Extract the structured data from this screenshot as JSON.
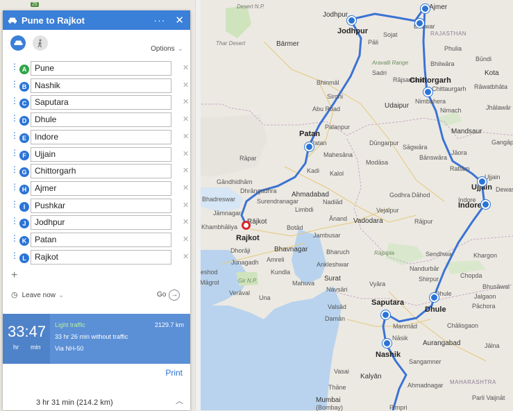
{
  "panel": {
    "title": "Pune to Rajkot",
    "more_label": "···",
    "close_label": "✕",
    "options_label": "Options",
    "stops": [
      {
        "letter": "A",
        "value": "Pune"
      },
      {
        "letter": "B",
        "value": "Nashik"
      },
      {
        "letter": "C",
        "value": "Saputara"
      },
      {
        "letter": "D",
        "value": "Dhule"
      },
      {
        "letter": "E",
        "value": "Indore"
      },
      {
        "letter": "F",
        "value": "Ujjain"
      },
      {
        "letter": "G",
        "value": "Chittorgarh"
      },
      {
        "letter": "H",
        "value": "Ajmer"
      },
      {
        "letter": "I",
        "value": "Pushkar"
      },
      {
        "letter": "J",
        "value": "Jodhpur"
      },
      {
        "letter": "K",
        "value": "Patan"
      },
      {
        "letter": "L",
        "value": "Rajkot"
      }
    ],
    "add_stop_label": "+",
    "leave_label": "Leave now",
    "go_label": "Go",
    "summary": {
      "time": "33:47",
      "hr_label": "hr",
      "min_label": "min",
      "traffic": "Light traffic",
      "distance": "2129.7 km",
      "no_traffic": "33 hr 26 min without traffic",
      "via": "Via NH-50"
    },
    "print_label": "Print",
    "step_summary": "3 hr 31 min (214.2 km)"
  },
  "map": {
    "route_color": "#3b73d4",
    "labels": {
      "desert_np": "Desert\nN.P.",
      "thar": "Thar Desert",
      "barmer": "Bärmer",
      "jodhpur": "Jodhpur",
      "jodhpur_bold": "Jodhpur",
      "ajmer": "Ajmer",
      "beawar": "Beawar",
      "sojat": "Sojat",
      "pali": "Pāli",
      "bhilwara": "Bhilwāra",
      "rajasthan": "RAJASTHAN",
      "phulia": "Phulia",
      "bundi": "Būndi",
      "kota": "Kota",
      "aravalli": "Aravalli Range",
      "sadri": "Sadri",
      "rajsamand": "Rājsamand",
      "chittorgarh": "Chittorgarh",
      "chittaurgarh": "Chittaurgarh",
      "rawatbhata": "Rāwatbhāta",
      "bhinmal": "Bhinmāl",
      "sirohi": "Sirohi",
      "udaipur": "Udaipur",
      "nimbahera": "Nimbahera",
      "jhalawar": "Jhālawār",
      "nimach": "Nimach",
      "aburoad": "Abu Road",
      "palanpur": "Palanpur",
      "mandsaur": "Mandsaur",
      "dungarpur": "Dūngarpur",
      "patan": "Patan",
      "patan_small": "Patan",
      "sagwara": "Sāgwāra",
      "gangapur": "Gangāpur",
      "mahesana": "Mahesāna",
      "banswara": "Bānswāra",
      "jaora": "Jāora",
      "rapar": "Rāpar",
      "kadi": "Kadi",
      "modasa": "Modāsa",
      "ratlam": "Ratlām",
      "kaloi": "Kalol",
      "gandhidham": "Gāndhidhām",
      "ujjain": "Ujjain",
      "ujjain_small": "Ujjain",
      "dewas": "Dewas",
      "dhrangadhra": "Dhrāngadhra",
      "ahmadabad": "Ahmadabad",
      "godhra": "Godhra",
      "dahod": "Dāhod",
      "bhadreswar": "Bhadreswar",
      "surendranagar": "Surendranagar",
      "nadiad": "Nadiād",
      "indore": "Indore",
      "indore_small": "Indore",
      "jamnagar": "Jāmnagar",
      "limbdi": "Limbdi",
      "anand": "Ānand",
      "vejalpur": "Vejalpur",
      "khambhaliya": "Khambhāliya",
      "rajkot": "Rājkot",
      "rajkot_bold": "Rajkot",
      "botad": "Botād",
      "vadodara": "Vadodara",
      "rajpur": "Rājpur",
      "jambusar": "Jambusar",
      "dhoraji": "Dhorāji",
      "bhavnagar": "Bhavnagar",
      "bharuch": "Bharuch",
      "sendhwa": "Sendhwa",
      "junagadh": "Junagadh",
      "amreli": "Amreli",
      "ankleshwar": "Ankleshwar",
      "rajpipla": "Rājpipla",
      "khargon": "Khargon",
      "porbandar": "Porbandar",
      "kundla": "Kundla",
      "chopda": "Chopda",
      "girnp": "Gir N.P.",
      "mahuva": "Mahuva",
      "surat": "Surat",
      "nandurbar": "Nandurbār",
      "shirpur": "Shirpur",
      "bhusawal": "Bhusāwal",
      "veraval": "Verāval",
      "una": "Una",
      "navsari": "Navsāri",
      "vyara": "Vyāra",
      "dhulesmall": "Dhule",
      "jalgaon": "Jalgaon",
      "valsad": "Valsād",
      "saputara": "Saputara",
      "pachora": "Pāchora",
      "daman": "Damān",
      "dhule": "Dhule",
      "manmad": "Manmād",
      "chalisgaon": "Chālisgaon",
      "nasik": "Nāsik",
      "aurangabad": "Aurangabad",
      "jalna": "Jālna",
      "nashik": "Nashik",
      "sangamner": "Sangamner",
      "maharashtra": "MAHARASHTRA",
      "kalyan": "Kalyān",
      "ahmadnagar": "Ahmadnagar",
      "thane": "Thāne",
      "mumbai": "Mumbai",
      "bombay": "(Bombay)",
      "pimpri": "Pimpri",
      "parli": "Parli Vaijnāt",
      "beshod": "eshod",
      "mangrol": "Māgrol",
      "vasai": "Vasai",
      "gir": "Gir N.P."
    }
  }
}
